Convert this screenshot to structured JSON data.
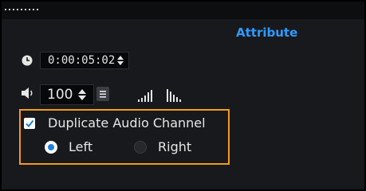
{
  "header": {
    "tab_label": "Attribute"
  },
  "time": {
    "value": "0:00:05:02",
    "icon": "clock-icon"
  },
  "volume": {
    "value": "100",
    "icon": "speaker-icon"
  },
  "audio_options": {
    "duplicate_label": "Duplicate Audio Channel",
    "duplicate_checked": true,
    "left_label": "Left",
    "right_label": "Right",
    "selected": "Left"
  },
  "colors": {
    "accent": "#2f9bff",
    "highlight_border": "#f39a1b",
    "panel_bg": "#17191c"
  }
}
